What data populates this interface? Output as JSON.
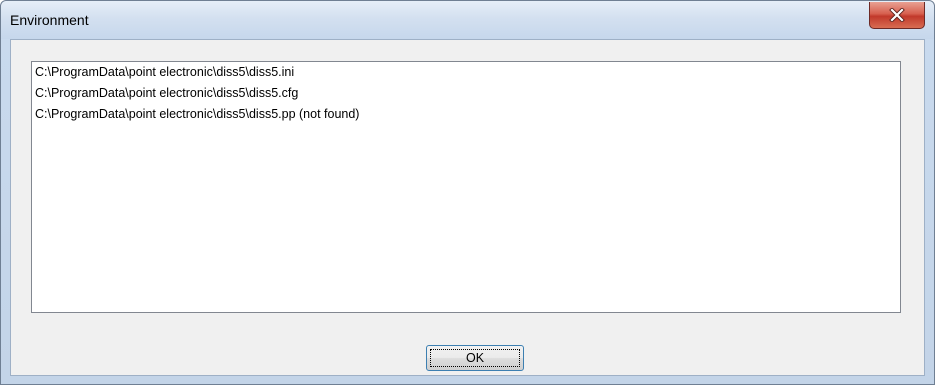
{
  "window": {
    "title": "Environment"
  },
  "close_button": {
    "icon": "close-icon"
  },
  "file_list": {
    "items": [
      {
        "label": "C:\\ProgramData\\point electronic\\diss5\\diss5.ini"
      },
      {
        "label": "C:\\ProgramData\\point electronic\\diss5\\diss5.cfg"
      },
      {
        "label": "C:\\ProgramData\\point electronic\\diss5\\diss5.pp (not found)"
      }
    ]
  },
  "buttons": {
    "ok_label": "OK"
  },
  "colors": {
    "close_button": "#c1392b",
    "focus_border": "#3c7fb1"
  }
}
